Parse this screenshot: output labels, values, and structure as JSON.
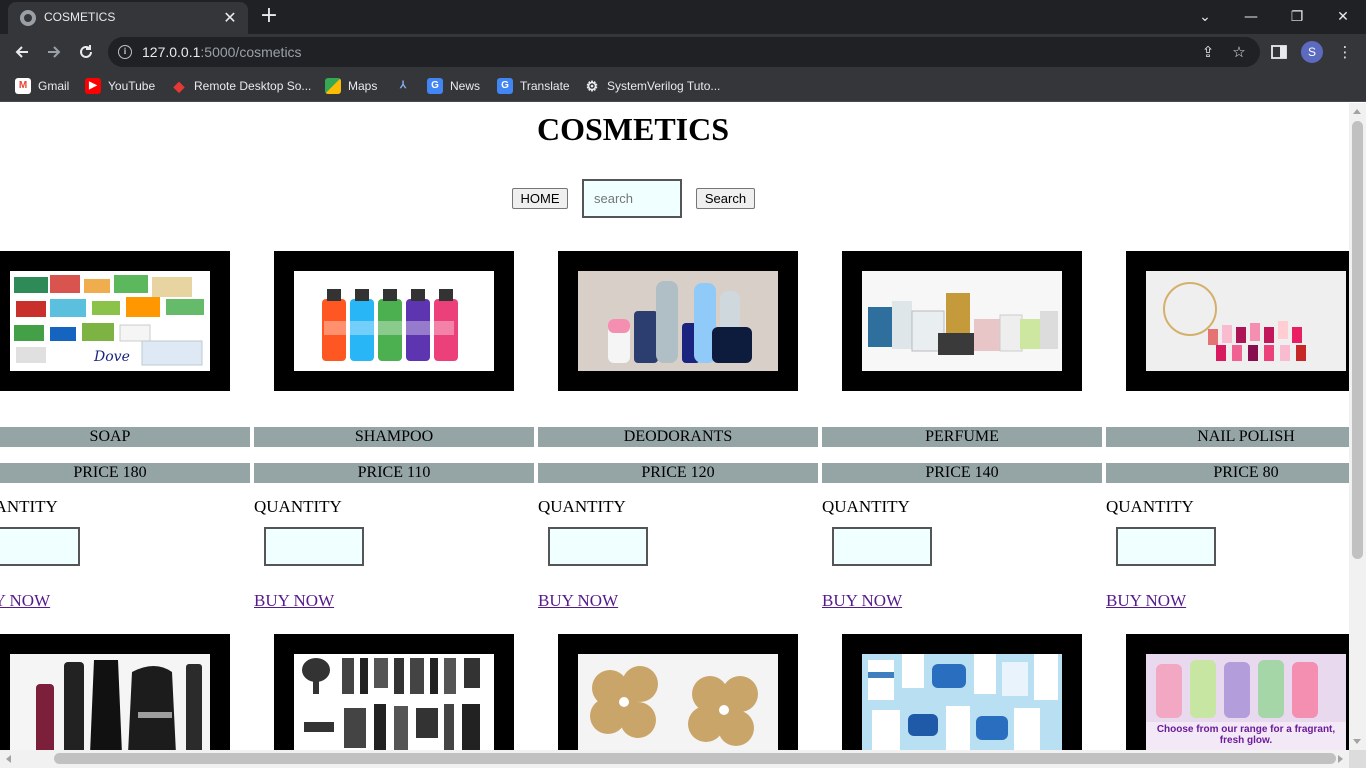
{
  "browser": {
    "tab_title": "COSMETICS",
    "tab_close": "✕",
    "new_tab": "+",
    "url_host": "127.0.0.1",
    "url_path": ":5000/cosmetics",
    "avatar_letter": "S",
    "icons": {
      "back": "arrow-left-icon",
      "forward": "arrow-right-icon",
      "reload": "reload-icon",
      "info": "info-icon",
      "share": "share-icon",
      "bookmark": "star-icon",
      "side_panel": "side-panel-icon",
      "menu": "kebab-menu-icon"
    },
    "bookmarks": [
      {
        "label": "Gmail",
        "icon": "gmail-icon",
        "color": "#ea4335"
      },
      {
        "label": "YouTube",
        "icon": "youtube-icon",
        "color": "#ff0000"
      },
      {
        "label": "Remote Desktop So...",
        "icon": "remote-desktop-icon",
        "color": "#e53935"
      },
      {
        "label": "Maps",
        "icon": "maps-icon",
        "color": "#34a853"
      },
      {
        "label": "",
        "icon": "bookmark-a-icon",
        "color": "#4285f4"
      },
      {
        "label": "News",
        "icon": "news-icon",
        "color": "#4285f4"
      },
      {
        "label": "Translate",
        "icon": "translate-icon",
        "color": "#4285f4"
      },
      {
        "label": "SystemVerilog Tuto...",
        "icon": "gear-icon",
        "color": "#bdc1c6"
      }
    ]
  },
  "page": {
    "title": "COSMETICS",
    "home_button": "HOME",
    "search_placeholder": "search",
    "search_button": "Search",
    "quantity_label": "QUANTITY",
    "buy_label": "BUY NOW",
    "products": [
      {
        "name": "SOAP",
        "price": "PRICE 180",
        "image": "soap-image"
      },
      {
        "name": "SHAMPOO",
        "price": "PRICE 110",
        "image": "shampoo-image"
      },
      {
        "name": "DEODORANTS",
        "price": "PRICE 120",
        "image": "deodorants-image"
      },
      {
        "name": "PERFUME",
        "price": "PRICE 140",
        "image": "perfume-image"
      },
      {
        "name": "NAIL POLISH",
        "price": "PRICE 80",
        "image": "nail-polish-image"
      }
    ],
    "second_row_images": [
      "makeup-image",
      "combs-image",
      "earrings-image",
      "skincare-image",
      "talc-image"
    ],
    "talc_caption": "Choose from our range for a fragrant, fresh glow."
  },
  "colors": {
    "name_bar": "#95a5a6",
    "input_bg": "#f0ffff",
    "link": "#551a8b",
    "frame": "#000000"
  }
}
